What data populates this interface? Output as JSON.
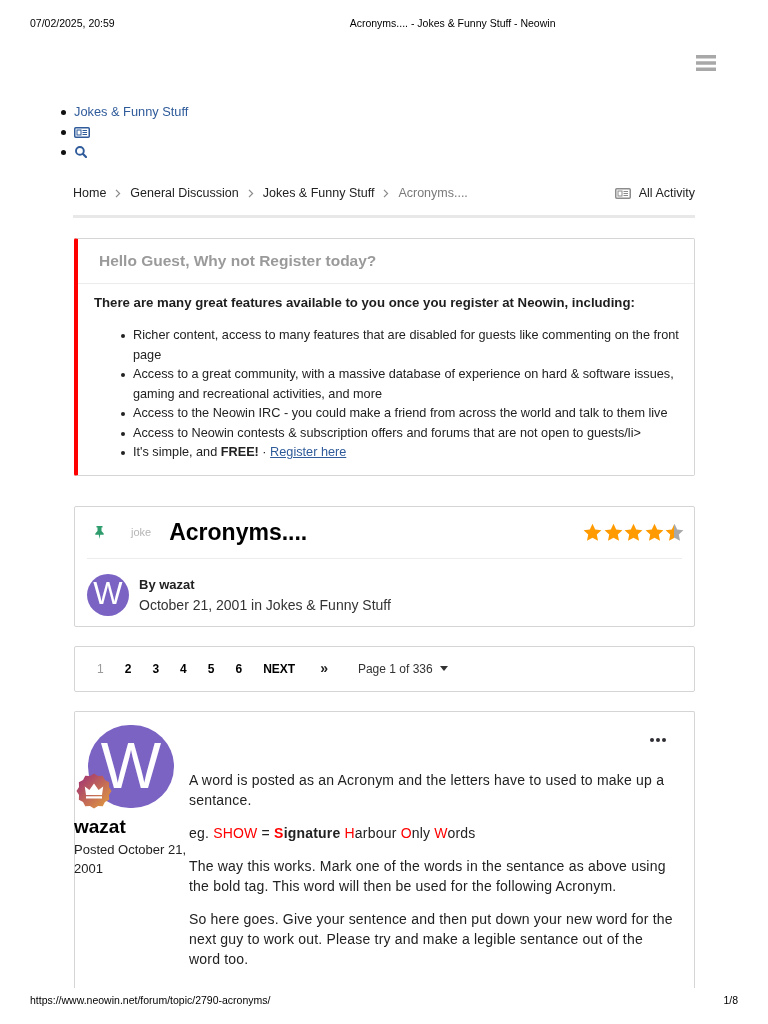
{
  "print_header": {
    "datetime": "07/02/2025, 20:59",
    "title": "Acronyms.... - Jokes & Funny Stuff - Neowin"
  },
  "nav_items": [
    {
      "kind": "link",
      "label": "Jokes & Funny Stuff"
    },
    {
      "kind": "activity"
    },
    {
      "kind": "search"
    }
  ],
  "breadcrumb": {
    "items": [
      {
        "label": "Home",
        "current": false
      },
      {
        "label": "General Discussion",
        "current": false
      },
      {
        "label": "Jokes & Funny Stuff",
        "current": false
      },
      {
        "label": "Acronyms....",
        "current": true
      }
    ],
    "activity_link": "All Activity"
  },
  "guest_notice": {
    "title": "Hello Guest, Why not Register today?",
    "intro": "There are many great features available to you once you register at Neowin, including:",
    "benefits": [
      {
        "text": "Richer content, access to many features that are disabled for guests like commenting on the front page"
      },
      {
        "text": "Access to a great community, with a massive database of experience on hard & software issues, gaming and recreational activities, and more"
      },
      {
        "text": "Access to the Neowin IRC - you could make a friend from across the world and talk to them live"
      },
      {
        "text": "Access to Neowin contests & subscription offers and forums that are not open to guests/li>"
      },
      {
        "text": "It's simple, and **FREE!** ·",
        "link": "Register here"
      }
    ]
  },
  "topic": {
    "pinned": true,
    "tag": "joke",
    "title": "Acronyms....",
    "stars": 4.5,
    "avatar_letter": "W",
    "author": "By wazat",
    "meta": "October 21, 2001 in Jokes & Funny Stuff"
  },
  "pagination": {
    "pages": [
      {
        "label": "1",
        "selected": true
      },
      {
        "label": "2",
        "selected": false
      },
      {
        "label": "3",
        "selected": false
      },
      {
        "label": "4",
        "selected": false
      },
      {
        "label": "5",
        "selected": false
      },
      {
        "label": "6",
        "selected": false
      }
    ],
    "next": "NEXT",
    "last": "»",
    "page_jump": "Page 1 of 336"
  },
  "post": {
    "avatar_letter": "W",
    "author": "wazat",
    "posted": "Posted October 21, 2001",
    "paragraphs": [
      {
        "kind": "plain",
        "text": "A word is posted as an Acronym and the letters have to used to make up a sentance."
      },
      {
        "kind": "segments",
        "segments": [
          {
            "text": "eg. ",
            "highlighted": false,
            "bold": false
          },
          {
            "text": "SHOW",
            "highlighted": true,
            "bold": false
          },
          {
            "text": " = ",
            "highlighted": false,
            "bold": false
          },
          {
            "text": "S",
            "highlighted": true,
            "bold": true
          },
          {
            "text": "ignature ",
            "highlighted": false,
            "bold": true
          },
          {
            "text": "H",
            "highlighted": true,
            "bold": false
          },
          {
            "text": "arbour ",
            "highlighted": false,
            "bold": false
          },
          {
            "text": "O",
            "highlighted": true,
            "bold": false
          },
          {
            "text": "nly ",
            "highlighted": false,
            "bold": false
          },
          {
            "text": "W",
            "highlighted": true,
            "bold": false
          },
          {
            "text": "ords",
            "highlighted": false,
            "bold": false
          }
        ]
      },
      {
        "kind": "plain",
        "text": "The way this works. Mark one of the words in the sentance as above using the bold tag. This word will then be used for the following Acronym."
      },
      {
        "kind": "plain",
        "text": "So here goes. Give your sentence and then put down your new word for the next guy to work out. Please try and make a legible sentance out of the word too."
      }
    ]
  },
  "print_footer": {
    "url": "https://www.neowin.net/forum/topic/2790-acronyms/",
    "page": "1/8"
  }
}
